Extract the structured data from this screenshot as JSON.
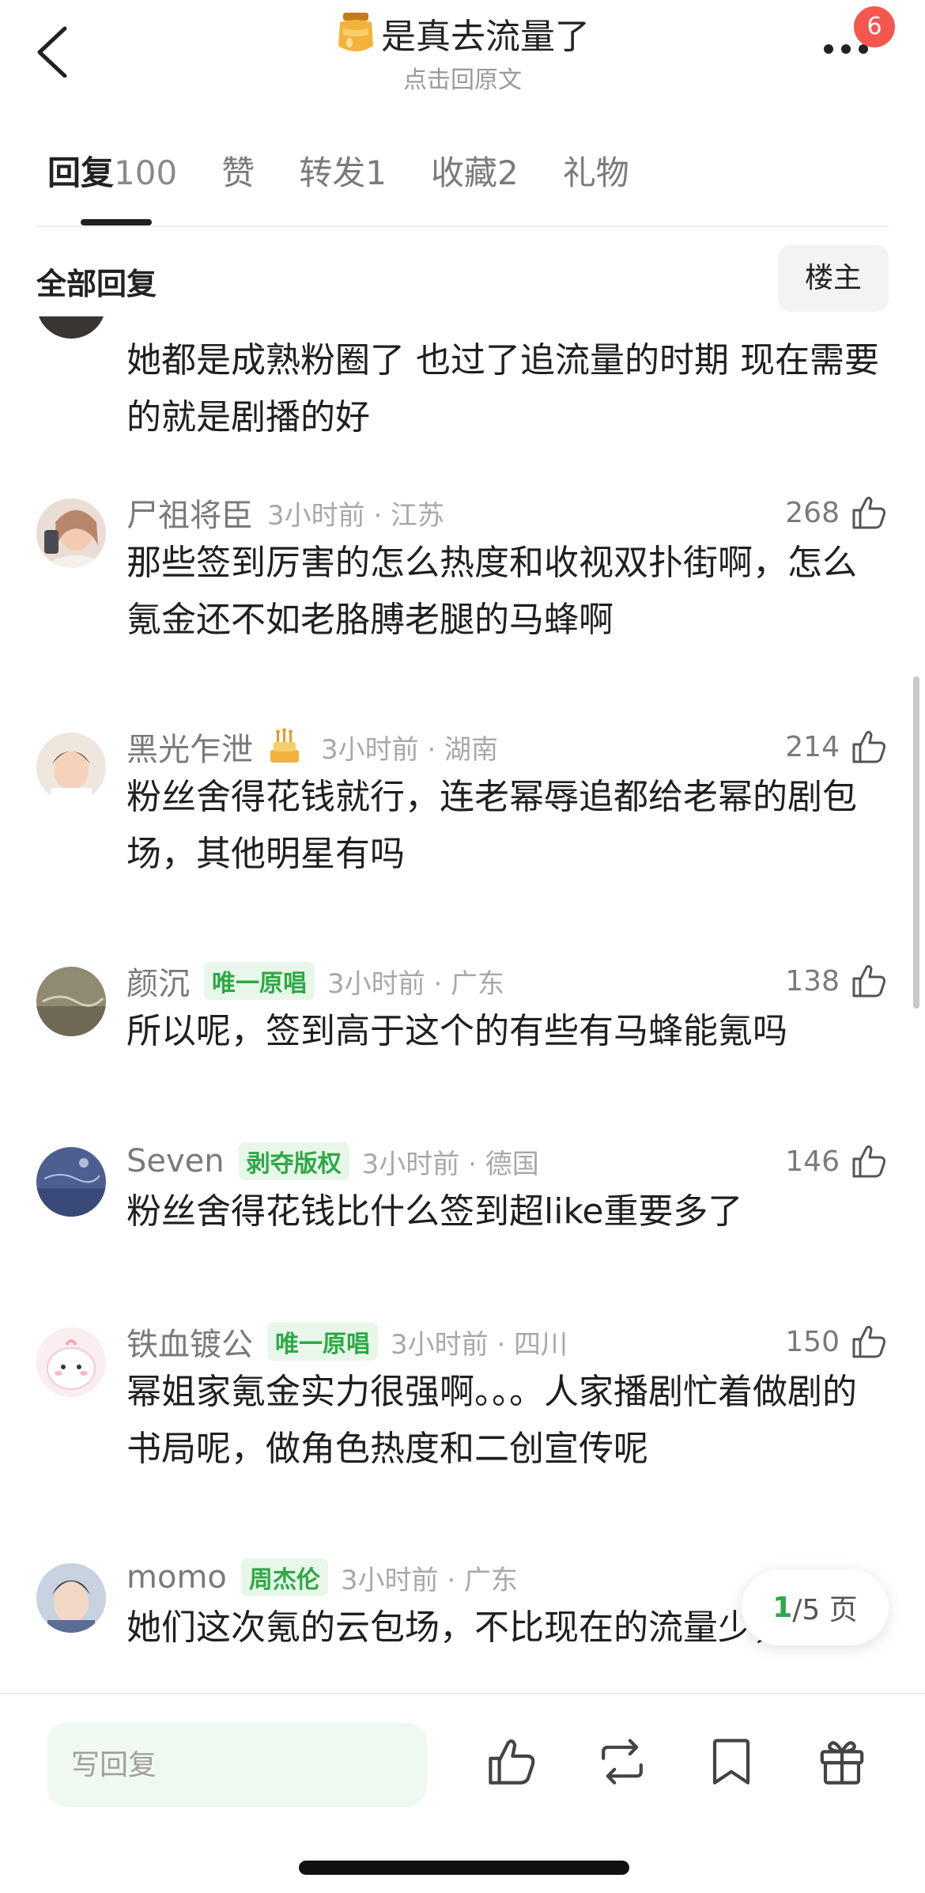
{
  "header": {
    "title": "是真去流量了",
    "subtitle": "点击回原文",
    "badge_count": "6",
    "title_icon": "honey-jar-icon"
  },
  "tabs": [
    {
      "label": "回复",
      "count": "100",
      "active": true
    },
    {
      "label": "赞",
      "count": ""
    },
    {
      "label": "转发",
      "count": "1"
    },
    {
      "label": "收藏",
      "count": "2"
    },
    {
      "label": "礼物",
      "count": ""
    }
  ],
  "filter": {
    "label": "全部回复",
    "owner_button": "楼主"
  },
  "comments": [
    {
      "username": "",
      "tag": "",
      "time": "",
      "likes": "",
      "text": "她都是成熟粉圈了 也过了追流量的时期 现在需要的就是剧播的好",
      "avatar_color": "#333333"
    },
    {
      "username": "尸祖将臣",
      "tag": "",
      "time": "3小时前 · 江苏",
      "likes": "268",
      "text": "那些签到厉害的怎么热度和收视双扑街啊，怎么氪金还不如老胳膊老腿的马蜂啊",
      "avatar_color": "#d9b8a5"
    },
    {
      "username": "黑光乍泄",
      "tag": "",
      "has_cake": true,
      "time": "3小时前 · 湖南",
      "likes": "214",
      "text": "粉丝舍得花钱就行，连老幂辱追都给老幂的剧包场，其他明星有吗",
      "avatar_color": "#b98a6c"
    },
    {
      "username": "颜沉",
      "tag": "唯一原唱",
      "time": "3小时前 · 广东",
      "likes": "138",
      "text": "所以呢，签到高于这个的有些有马蜂能氪吗",
      "avatar_color": "#8c8a6e"
    },
    {
      "username": "Seven",
      "tag": "剥夺版权",
      "time": "3小时前 · 德国",
      "likes": "146",
      "text": "粉丝舍得花钱比什么签到超like重要多了",
      "avatar_color": "#5a6c9a"
    },
    {
      "username": "铁血镀公",
      "tag": "唯一原唱",
      "time": "3小时前 · 四川",
      "likes": "150",
      "text": "幂姐家氪金实力很强啊。。。人家播剧忙着做剧的书局呢，做角色热度和二创宣传呢",
      "avatar_color": "#f6d8dc"
    },
    {
      "username": "momo",
      "tag": "周杰伦",
      "time": "3小时前 · 广东",
      "likes": "",
      "text": "她们这次氪的云包场，不比现在的流量少，",
      "avatar_color": "#a8b4c8"
    }
  ],
  "pagination": {
    "current": "1",
    "rest": "/5 页"
  },
  "bottom": {
    "reply_placeholder": "写回复"
  }
}
